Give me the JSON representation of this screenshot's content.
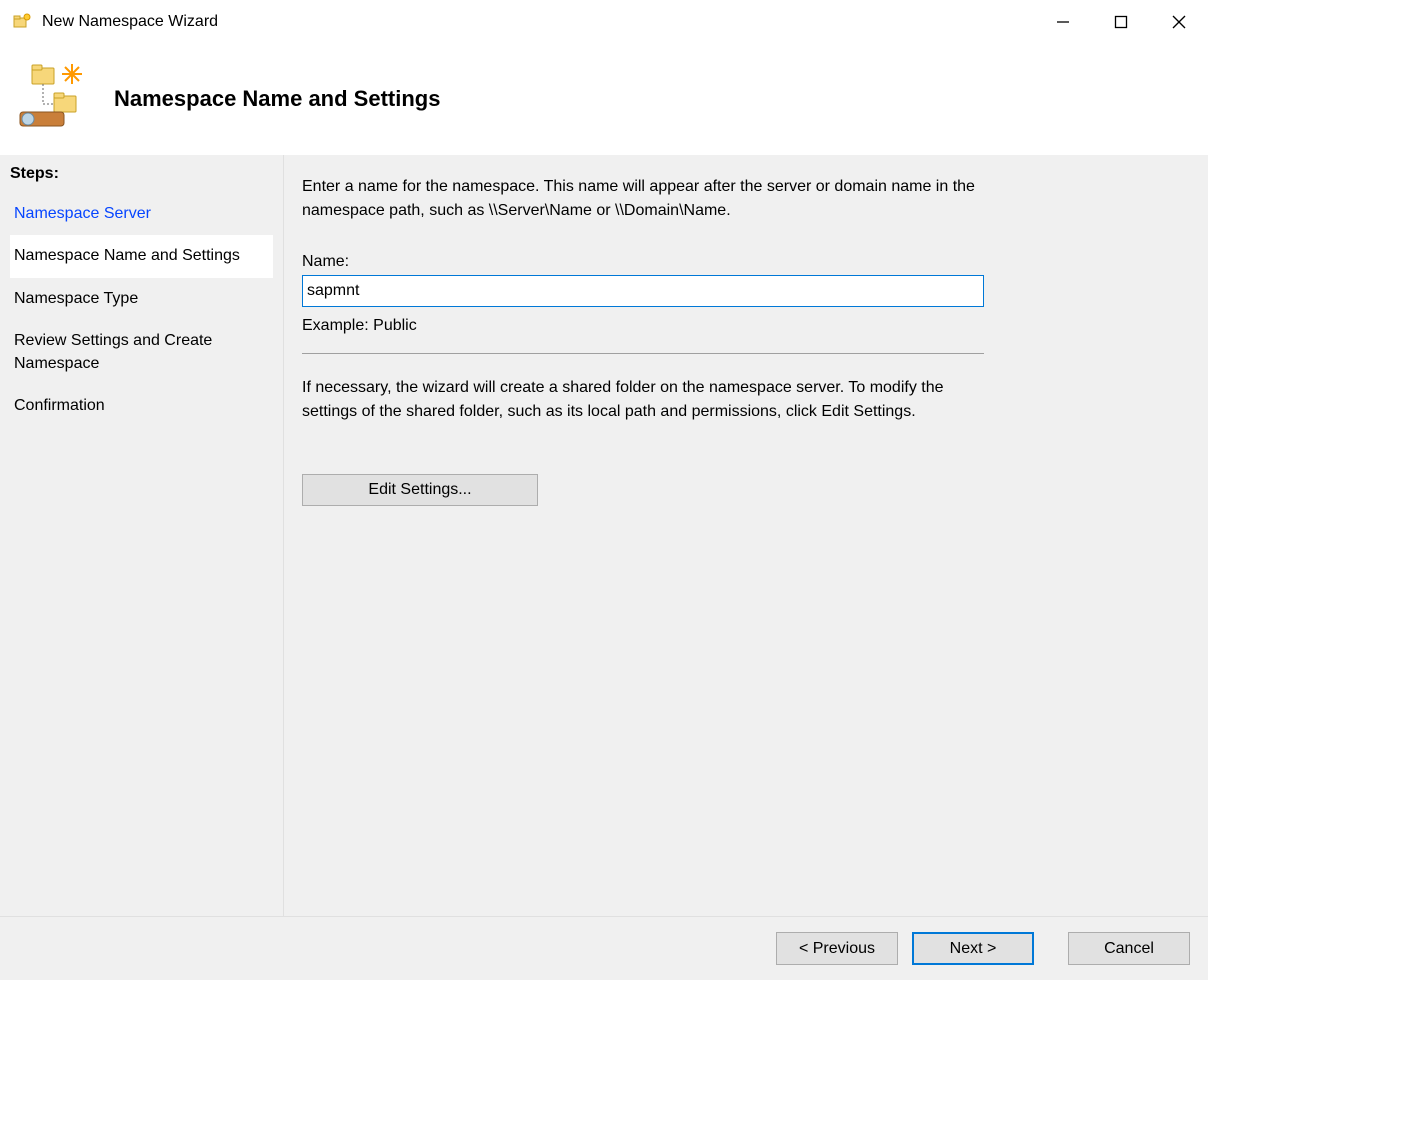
{
  "window": {
    "title": "New Namespace Wizard"
  },
  "header": {
    "title": "Namespace Name and Settings"
  },
  "sidebar": {
    "steps_label": "Steps:",
    "steps": [
      "Namespace Server",
      "Namespace Name and Settings",
      "Namespace Type",
      "Review Settings and Create Namespace",
      "Confirmation"
    ]
  },
  "content": {
    "instruction": "Enter a name for the namespace. This name will appear after the server or domain name in the namespace path, such as \\\\Server\\Name or \\\\Domain\\Name.",
    "name_label": "Name:",
    "name_value": "sapmnt",
    "example_label": "Example: Public",
    "instruction2": "If necessary, the wizard will create a shared folder on the namespace server. To modify the settings of the shared folder, such as its local path and permissions, click Edit Settings.",
    "edit_settings_label": "Edit Settings..."
  },
  "footer": {
    "previous_label": "< Previous",
    "next_label": "Next >",
    "cancel_label": "Cancel"
  }
}
